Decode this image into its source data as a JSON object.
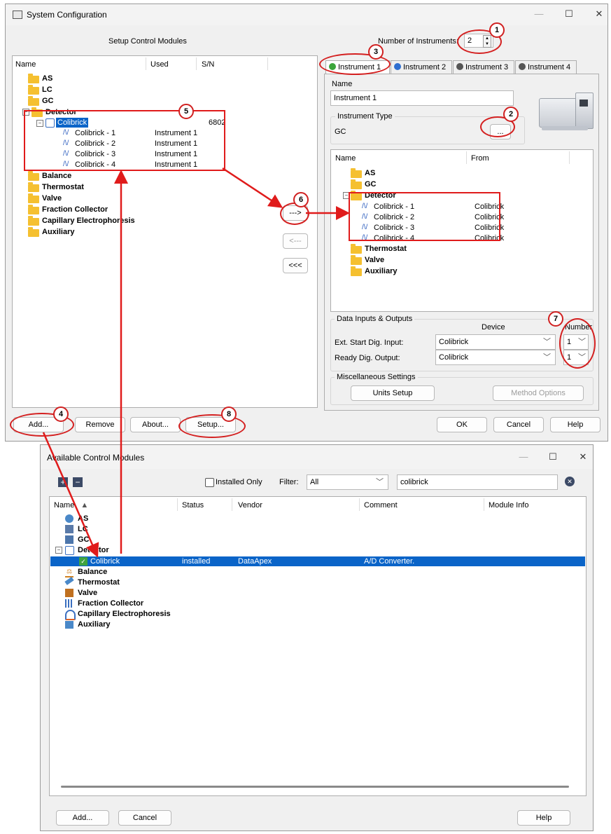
{
  "sys": {
    "title": "System Configuration",
    "setup_title": "Setup Control Modules",
    "cols": {
      "name": "Name",
      "used": "Used",
      "sn": "S/N"
    },
    "tree": {
      "as": "AS",
      "lc": "LC",
      "gc": "GC",
      "detector": "Detector",
      "colibrick": "Colibrick",
      "colibrick_sn": "6802",
      "subs": [
        {
          "name": "Colibrick - 1",
          "used": "Instrument 1"
        },
        {
          "name": "Colibrick - 2",
          "used": "Instrument 1"
        },
        {
          "name": "Colibrick - 3",
          "used": "Instrument 1"
        },
        {
          "name": "Colibrick - 4",
          "used": "Instrument 1"
        }
      ],
      "balance": "Balance",
      "thermostat": "Thermostat",
      "valve": "Valve",
      "fraction": "Fraction Collector",
      "ce": "Capillary Electrophoresis",
      "aux": "Auxiliary"
    },
    "num_instruments_label": "Number of Instruments:",
    "num_instruments": "2",
    "tabs": [
      "Instrument 1",
      "Instrument 2",
      "Instrument 3",
      "Instrument 4"
    ],
    "name_label": "Name",
    "name_value": "Instrument 1",
    "type_label": "Instrument Type",
    "type_value": "GC",
    "dots": "...",
    "inst_cols": {
      "name": "Name",
      "from": "From"
    },
    "inst_tree": {
      "as": "AS",
      "gc": "GC",
      "detector": "Detector",
      "subs": [
        {
          "name": "Colibrick - 1",
          "from": "Colibrick"
        },
        {
          "name": "Colibrick - 2",
          "from": "Colibrick"
        },
        {
          "name": "Colibrick - 3",
          "from": "Colibrick"
        },
        {
          "name": "Colibrick - 4",
          "from": "Colibrick"
        }
      ],
      "thermostat": "Thermostat",
      "valve": "Valve",
      "aux": "Auxiliary"
    },
    "move_right": "--->",
    "move_left": "<---",
    "move_all_left": "<<<",
    "dio_label": "Data Inputs & Outputs",
    "device_hdr": "Device",
    "number_hdr": "Number",
    "ext_start": "Ext. Start Dig. Input:",
    "ext_start_device": "Colibrick",
    "ext_start_num": "1",
    "ready": "Ready Dig. Output:",
    "ready_device": "Colibrick",
    "ready_num": "1",
    "misc_label": "Miscellaneous Settings",
    "units_setup": "Units Setup",
    "method_options": "Method Options",
    "add": "Add...",
    "remove": "Remove",
    "about": "About...",
    "setup": "Setup...",
    "ok": "OK",
    "cancel": "Cancel",
    "help": "Help"
  },
  "acm": {
    "title": "Available Control Modules",
    "installed_only": "Installed Only",
    "filter_label": "Filter:",
    "filter_value": "All",
    "search_value": "colibrick",
    "cols": {
      "name": "Name",
      "status": "Status",
      "vendor": "Vendor",
      "comment": "Comment",
      "info": "Module Info"
    },
    "tree": {
      "as": "AS",
      "lc": "LC",
      "gc": "GC",
      "detector": "Detector",
      "colibrick": "Colibrick",
      "status": "installed",
      "vendor": "DataApex",
      "comment": "A/D Converter.",
      "balance": "Balance",
      "thermostat": "Thermostat",
      "valve": "Valve",
      "fraction": "Fraction Collector",
      "ce": "Capillary Electrophoresis",
      "aux": "Auxiliary"
    },
    "add": "Add...",
    "cancel": "Cancel",
    "help": "Help"
  },
  "callouts": [
    "1",
    "2",
    "3",
    "4",
    "5",
    "6",
    "7",
    "8"
  ],
  "colors": {
    "selection": "#0a64c8",
    "annotation": "#e01b1b",
    "folder": "#f5c030"
  }
}
